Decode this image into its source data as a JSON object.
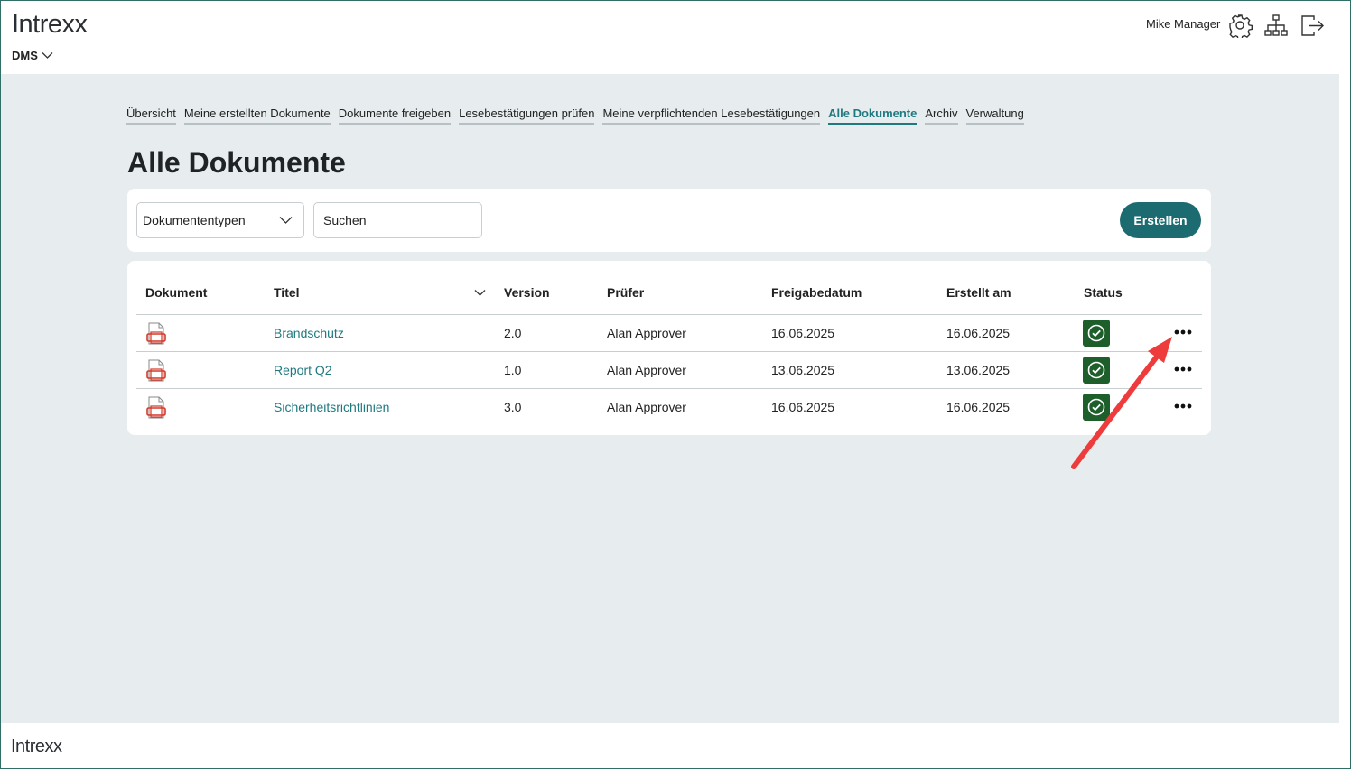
{
  "header": {
    "logo": "Intrexx",
    "app_switch": "DMS",
    "user_name": "Mike Manager",
    "icons": [
      "gear-icon",
      "sitemap-icon",
      "logout-icon"
    ]
  },
  "tabs": [
    {
      "label": "Übersicht",
      "active": false
    },
    {
      "label": "Meine erstellten Dokumente",
      "active": false
    },
    {
      "label": "Dokumente freigeben",
      "active": false
    },
    {
      "label": "Lesebestätigungen prüfen",
      "active": false
    },
    {
      "label": "Meine verpflichtenden Lesebestätigungen",
      "active": false
    },
    {
      "label": "Alle Dokumente",
      "active": true
    },
    {
      "label": "Archiv",
      "active": false
    },
    {
      "label": "Verwaltung",
      "active": false
    }
  ],
  "page_title": "Alle Dokumente",
  "toolbar": {
    "doctype_select": "Dokumententypen",
    "search_placeholder": "Suchen",
    "create_label": "Erstellen"
  },
  "table": {
    "columns": [
      "Dokument",
      "Titel",
      "Version",
      "Prüfer",
      "Freigabedatum",
      "Erstellt am",
      "Status"
    ],
    "rows": [
      {
        "title": "Brandschutz",
        "version": "2.0",
        "reviewer": "Alan Approver",
        "release_date": "16.06.2025",
        "created": "16.06.2025",
        "status": "approved"
      },
      {
        "title": "Report Q2",
        "version": "1.0",
        "reviewer": "Alan Approver",
        "release_date": "13.06.2025",
        "created": "13.06.2025",
        "status": "approved"
      },
      {
        "title": "Sicherheitsrichtlinien",
        "version": "3.0",
        "reviewer": "Alan Approver",
        "release_date": "16.06.2025",
        "created": "16.06.2025",
        "status": "approved"
      }
    ]
  },
  "footer": {
    "logo": "Intrexx"
  },
  "colors": {
    "accent": "#1f7a80",
    "button": "#1c6b71",
    "status_ok": "#1e5e2b",
    "background": "#e7ecee",
    "annotation_arrow": "#ee3b3b"
  }
}
